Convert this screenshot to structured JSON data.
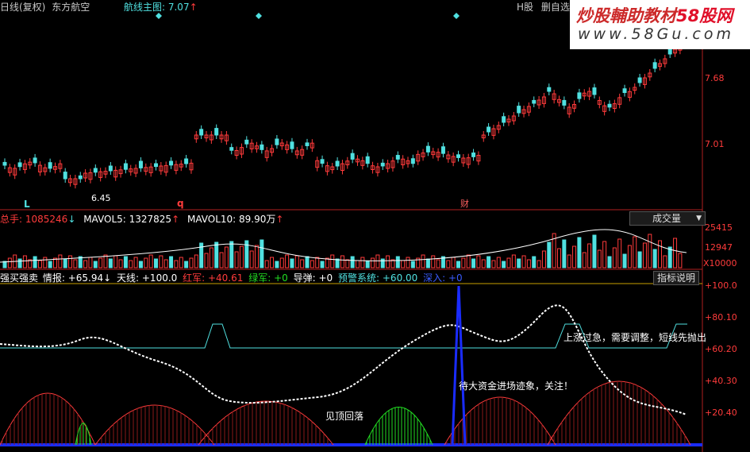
{
  "header": {
    "period_label": "日线(复权)",
    "stock_name": "东方航空",
    "indicator_label": "航线主图: 7.07",
    "indicator_arrow": "↑",
    "market_tag": "H股",
    "self_select_btn": "删自选"
  },
  "watermark": {
    "title": "炒股輔助教材",
    "brand": "58股网",
    "url": "www.58Gu.com"
  },
  "main_chart": {
    "price_ticks": [
      "7.68",
      "7.01"
    ],
    "low_label": "6.45",
    "markers": [
      "L",
      "q",
      "财"
    ]
  },
  "volume_panel": {
    "total_label": "总手: ",
    "total_value": "1085246",
    "mavol5_label": "MAVOL5: ",
    "mavol5_value": "1327825",
    "mavol10_label": "MAVOL10: ",
    "mavol10_value": "89.90万",
    "selector": "成交量",
    "ticks": [
      "25415",
      "12947",
      "X10000"
    ]
  },
  "indicator_panel": {
    "name": "强买强卖",
    "info_label": "情报: ",
    "info_value": "+65.94",
    "tianxian_label": "天线: ",
    "tianxian_value": "+100.0",
    "hongjun_label": "红军: ",
    "hongjun_value": "+40.61",
    "lvjun_label": "绿军: ",
    "lvjun_value": "+0",
    "daodan_label": "导弹: ",
    "daodan_value": "+0",
    "yujing_label": "预警系统: ",
    "yujing_value": "+60.00",
    "shenru_label": "深入: ",
    "shenru_value": "+0",
    "help_btn": "指标说明",
    "ticks": [
      "+100.0",
      "+80.10",
      "+60.20",
      "+40.30",
      "+20.40"
    ],
    "annotations": {
      "overheat": "上涨过急，需要调整，短线先抛出",
      "big_money": "待大资金进场迹象，关注！",
      "top_fall": "见顶回落"
    }
  },
  "colors": {
    "up": "#ff3b3b",
    "down": "#50e0e0",
    "axis": "#b02020",
    "blue": "#1a2cff",
    "green": "#22dd22"
  }
}
